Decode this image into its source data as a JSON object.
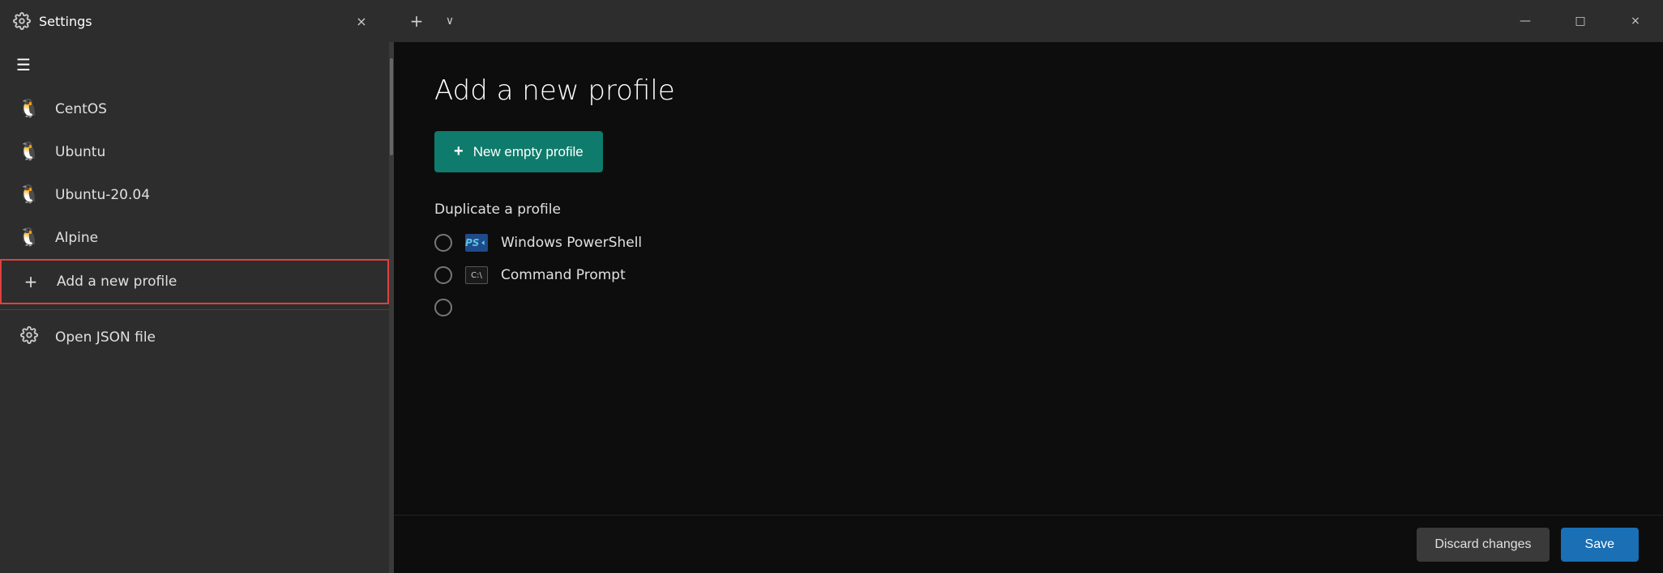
{
  "titlebar": {
    "title": "Settings",
    "tab_plus": "+",
    "tab_chevron": "∨",
    "close_label": "×",
    "minimize_label": "—",
    "maximize_label": "□"
  },
  "sidebar": {
    "menu_icon": "☰",
    "items": [
      {
        "id": "centos",
        "label": "CentOS",
        "icon": "🐧"
      },
      {
        "id": "ubuntu",
        "label": "Ubuntu",
        "icon": "🐧"
      },
      {
        "id": "ubuntu2004",
        "label": "Ubuntu-20.04",
        "icon": "🐧"
      },
      {
        "id": "alpine",
        "label": "Alpine",
        "icon": "🐧"
      },
      {
        "id": "add-profile",
        "label": "Add a new profile",
        "icon": "+"
      }
    ],
    "divider": true,
    "json_item": {
      "label": "Open JSON file",
      "icon": "⚙"
    }
  },
  "content": {
    "title": "Add a new profile",
    "new_empty_profile_btn": "New empty profile",
    "duplicate_label": "Duplicate a profile",
    "profiles": [
      {
        "id": "powershell",
        "name": "Windows PowerShell",
        "icon_type": "ps"
      },
      {
        "id": "cmd",
        "name": "Command Prompt",
        "icon_type": "cmd"
      }
    ]
  },
  "footer": {
    "discard_label": "Discard changes",
    "save_label": "Save"
  }
}
